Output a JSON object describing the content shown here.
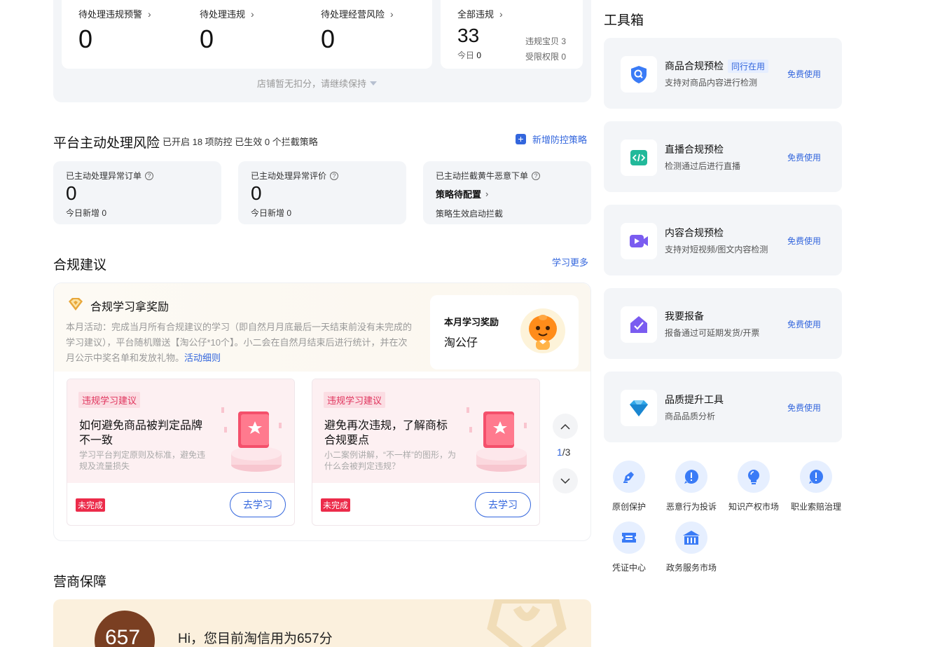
{
  "top_stats": {
    "items": [
      {
        "label": "待处理违规预警",
        "value": "0"
      },
      {
        "label": "待处理违规",
        "value": "0"
      },
      {
        "label": "待处理经营风险",
        "value": "0"
      }
    ],
    "all": {
      "label": "全部违规",
      "value": "33",
      "today_label": "今日",
      "today_value": "0",
      "items_label": "违规宝贝",
      "items_value": "3",
      "rights_label": "受限权限",
      "rights_value": "0"
    },
    "hint": "店铺暂无扣分，请继续保持"
  },
  "platform_risk": {
    "title": "平台主动处理风险",
    "subtitle": "已开启 18 项防控 已生效 0 个拦截策略",
    "add_label": "新增防控策略",
    "cards": [
      {
        "label": "已主动处理异常订单",
        "value": "0",
        "today": "今日新增",
        "today_value": "0"
      },
      {
        "label": "已主动处理异常评价",
        "value": "0",
        "today": "今日新增",
        "today_value": "0"
      },
      {
        "label": "已主动拦截黄牛恶意下单",
        "value": "策略待配置",
        "today": "策略生效启动拦截"
      }
    ]
  },
  "compliance": {
    "title": "合规建议",
    "more": "学习更多",
    "reward_title": "合规学习拿奖励",
    "reward_desc": "本月活动：完成当月所有合规建议的学习（即自然月月底最后一天结束前没有未完成的学习建议），平台随机赠送【淘公仔*10个】。小二会在自然月结束后进行统计，并在次月公示中奖名单和发放礼物。",
    "reward_link": "活动细则",
    "prize_label": "本月学习奖励",
    "prize_name": "淘公仔",
    "cards": [
      {
        "tag": "违规学习建议",
        "title": "如何避免商品被判定品牌不一致",
        "desc": "学习平台判定原则及标准，避免违规及流量损失",
        "status": "未完成",
        "button": "去学习"
      },
      {
        "tag": "违规学习建议",
        "title": "避免再次违规，了解商标合规要点",
        "desc": "小二案例讲解，“不一样”的图形，为什么会被判定违规？",
        "status": "未完成",
        "button": "去学习"
      }
    ],
    "page_current": "1",
    "page_total": "/3"
  },
  "merchant": {
    "title": "营商保障",
    "score": "657",
    "greeting": "Hi，您目前淘信用为657分"
  },
  "toolbox": {
    "title": "工具箱",
    "tools": [
      {
        "name": "商品合规预检",
        "tag": "同行在用",
        "desc": "支持对商品内容进行检测",
        "action": "免费使用",
        "icon": "shield-search-icon"
      },
      {
        "name": "直播合规预检",
        "desc": "检测通过后进行直播",
        "action": "免费使用",
        "icon": "code-icon"
      },
      {
        "name": "内容合规预检",
        "desc": "支持对短视频/图文内容检测",
        "action": "免费使用",
        "icon": "video-camera-icon"
      },
      {
        "name": "我要报备",
        "desc": "报备通过可延期发货/开票",
        "action": "免费使用",
        "icon": "house-check-icon"
      },
      {
        "name": "品质提升工具",
        "desc": "商品品质分析",
        "action": "免费使用",
        "icon": "diamond-icon"
      }
    ],
    "mini_tools": [
      {
        "label": "原创保护",
        "icon": "pen-icon"
      },
      {
        "label": "恶意行为投诉",
        "icon": "alert-bubble-icon"
      },
      {
        "label": "知识产权市场",
        "icon": "lightbulb-icon"
      },
      {
        "label": "职业索赔治理",
        "icon": "alert-bubble-icon"
      },
      {
        "label": "凭证中心",
        "icon": "ticket-icon"
      },
      {
        "label": "政务服务市场",
        "icon": "government-icon"
      }
    ]
  },
  "colors": {
    "accent": "#3366dd",
    "danger": "#ec2b4a",
    "card_bg": "#f3f5f8"
  }
}
